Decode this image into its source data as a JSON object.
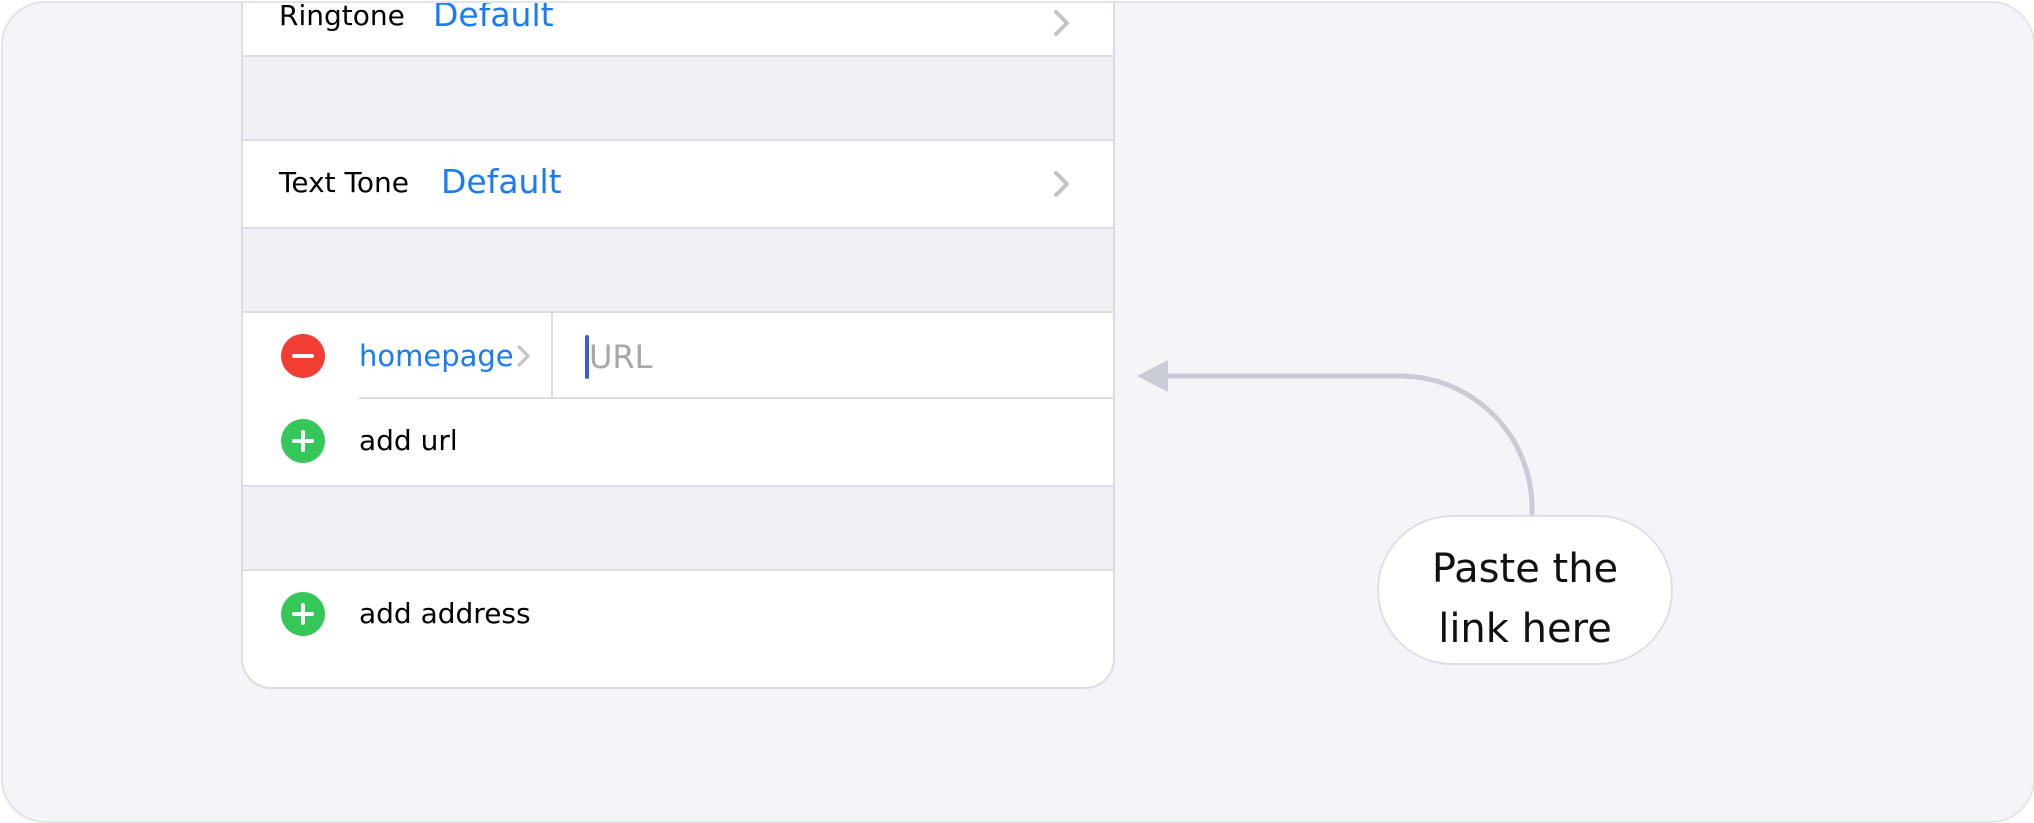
{
  "contact_form": {
    "ringtone": {
      "label": "Ringtone",
      "value": "Default"
    },
    "text_tone": {
      "label": "Text Tone",
      "value": "Default"
    },
    "url_row": {
      "type_label": "homepage",
      "placeholder": "URL",
      "value": ""
    },
    "add_url_label": "add url",
    "add_address_label": "add address"
  },
  "callout": {
    "lines": [
      "Paste the",
      "link here"
    ]
  },
  "colors": {
    "accent_blue": "#1a7cf5",
    "delete_red": "#f23d35",
    "add_green": "#35c759",
    "connector_gray": "#c9ccd4"
  },
  "icons": {
    "disclosure": "chevron-right-icon",
    "remove": "minus-circle-icon",
    "add": "plus-circle-icon",
    "callout_pointer": "arrow-left-icon"
  }
}
